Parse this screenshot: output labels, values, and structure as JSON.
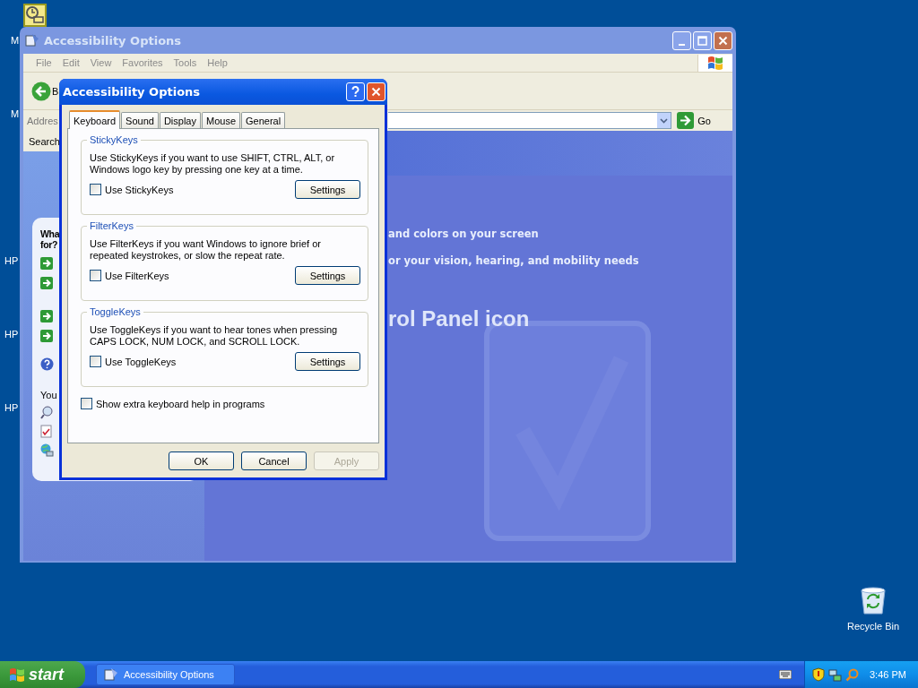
{
  "desktop": {
    "edge_labels": [
      "M",
      "M",
      "HP",
      "HP",
      "HP"
    ],
    "icons": [
      {
        "label": "Recycle Bin"
      }
    ]
  },
  "explorer": {
    "title": "Accessibility Options",
    "active": false,
    "menu": [
      "File",
      "Edit",
      "View",
      "Favorites",
      "Tools",
      "Help"
    ],
    "back_label": "B",
    "address_label": "Addres",
    "search_label": "Search",
    "go_label": "Go",
    "task_pane": {
      "heading": [
        "Wha",
        "for?"
      ],
      "you_label": "You"
    },
    "content": {
      "lines": [
        "and colors on your screen",
        "or your vision, hearing, and mobility needs"
      ],
      "heading": "rol Panel icon"
    }
  },
  "dialog": {
    "title": "Accessibility Options",
    "tabs": [
      {
        "label": "Keyboard",
        "selected": true
      },
      {
        "label": "Sound",
        "selected": false
      },
      {
        "label": "Display",
        "selected": false
      },
      {
        "label": "Mouse",
        "selected": false
      },
      {
        "label": "General",
        "selected": false
      }
    ],
    "groups": [
      {
        "title": "StickyKeys",
        "description": "Use StickyKeys if you want to use SHIFT, CTRL, ALT, or Windows logo key by pressing one key at a time.",
        "checkbox": {
          "label": "Use StickyKeys",
          "checked": false
        },
        "button": "Settings"
      },
      {
        "title": "FilterKeys",
        "description": "Use FilterKeys if you want Windows to ignore brief or repeated keystrokes, or slow the repeat rate.",
        "checkbox": {
          "label": "Use FilterKeys",
          "checked": false
        },
        "button": "Settings"
      },
      {
        "title": "ToggleKeys",
        "description": "Use ToggleKeys if you want to hear tones when pressing CAPS LOCK, NUM LOCK, and SCROLL LOCK.",
        "checkbox": {
          "label": "Use ToggleKeys",
          "checked": false
        },
        "button": "Settings"
      }
    ],
    "extra": {
      "label": "Show extra keyboard help in programs",
      "checked": false
    },
    "buttons": [
      {
        "label": "OK",
        "disabled": false
      },
      {
        "label": "Cancel",
        "disabled": false
      },
      {
        "label": "Apply",
        "disabled": true
      }
    ]
  },
  "taskbar": {
    "start": "start",
    "tasks": [
      {
        "label": "Accessibility Options",
        "selected": false
      }
    ],
    "clock": "3:46 PM"
  }
}
